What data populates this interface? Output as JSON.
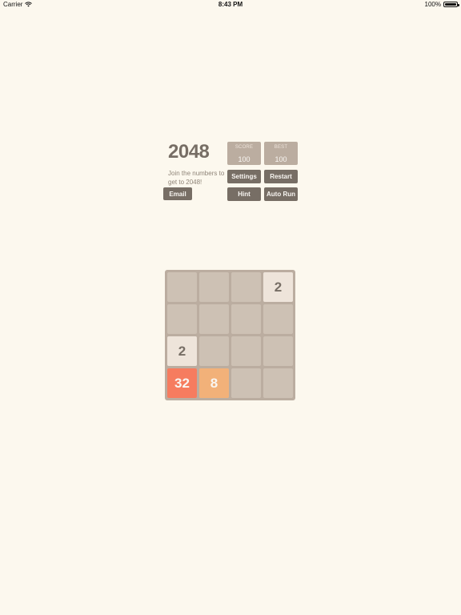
{
  "status_bar": {
    "carrier": "Carrier",
    "time": "8:43 PM",
    "battery": "100%"
  },
  "header": {
    "title": "2048",
    "subtitle": "Join the numbers to get to 2048!"
  },
  "scores": {
    "score_label": "SCORE",
    "score_value": "100",
    "best_label": "BEST",
    "best_value": "100"
  },
  "buttons": {
    "email": "Email",
    "settings": "Settings",
    "restart": "Restart",
    "hint": "Hint",
    "auto_run": "Auto Run"
  },
  "board": {
    "tiles": [
      {
        "row": 0,
        "col": 3,
        "value": "2",
        "bg": "#eee4da",
        "color": "#776e65"
      },
      {
        "row": 2,
        "col": 0,
        "value": "2",
        "bg": "#eee4da",
        "color": "#776e65"
      },
      {
        "row": 3,
        "col": 0,
        "value": "32",
        "bg": "#f67c5f",
        "color": "#f9f6f2"
      },
      {
        "row": 3,
        "col": 1,
        "value": "8",
        "bg": "#f2b179",
        "color": "#f9f6f2"
      }
    ]
  },
  "colors": {
    "background": "#fcf8ee",
    "board": "#bbada0",
    "empty_cell": "#cdc1b4",
    "button": "#776e65",
    "title": "#776e65"
  }
}
